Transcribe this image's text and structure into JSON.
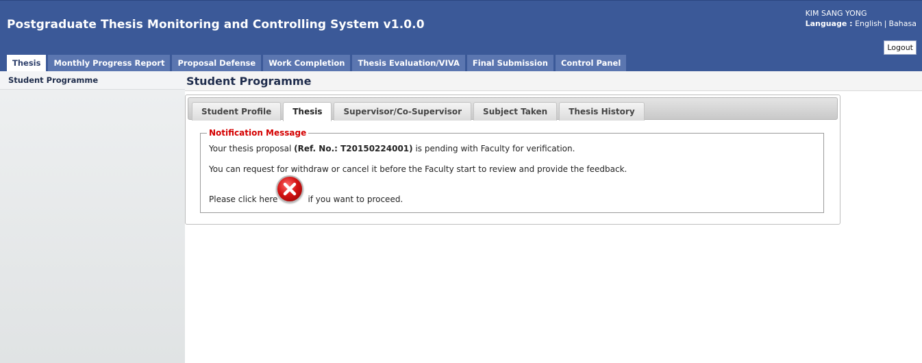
{
  "header": {
    "title": "Postgraduate Thesis Monitoring and Controlling System v1.0.0",
    "user_name": "KIM SANG YONG",
    "language_label": "Language :",
    "languages": [
      "English",
      "Bahasa"
    ],
    "logout_label": "Logout"
  },
  "nav": {
    "tabs": [
      {
        "label": "Thesis",
        "active": true
      },
      {
        "label": "Monthly Progress Report"
      },
      {
        "label": "Proposal Defense"
      },
      {
        "label": "Work Completion"
      },
      {
        "label": "Thesis Evaluation/VIVA"
      },
      {
        "label": "Final Submission"
      },
      {
        "label": "Control Panel"
      }
    ]
  },
  "sidebar": {
    "items": [
      {
        "label": "Student Programme"
      }
    ]
  },
  "content": {
    "page_title": "Student Programme",
    "subtabs": [
      {
        "label": "Student Profile"
      },
      {
        "label": "Thesis",
        "active": true
      },
      {
        "label": "Supervisor/Co-Supervisor"
      },
      {
        "label": "Subject Taken"
      },
      {
        "label": "Thesis History"
      }
    ],
    "notification": {
      "legend": "Notification Message",
      "line1_prefix": "Your thesis proposal ",
      "line1_ref": "(Ref. No.: T20150224001)",
      "line1_suffix": " is pending with Faculty for verification.",
      "line2": "You can request for withdraw or cancel it before the Faculty start to review and provide the feedback.",
      "line3_prefix": "Please click here",
      "line3_suffix": "if you want to proceed.",
      "cancel_icon": "cancel-x-icon"
    }
  },
  "colors": {
    "header_bg": "#3b5998",
    "nav_tab_bg": "#5b76b0",
    "legend_red": "#d40000",
    "cancel_red": "#d41414"
  }
}
